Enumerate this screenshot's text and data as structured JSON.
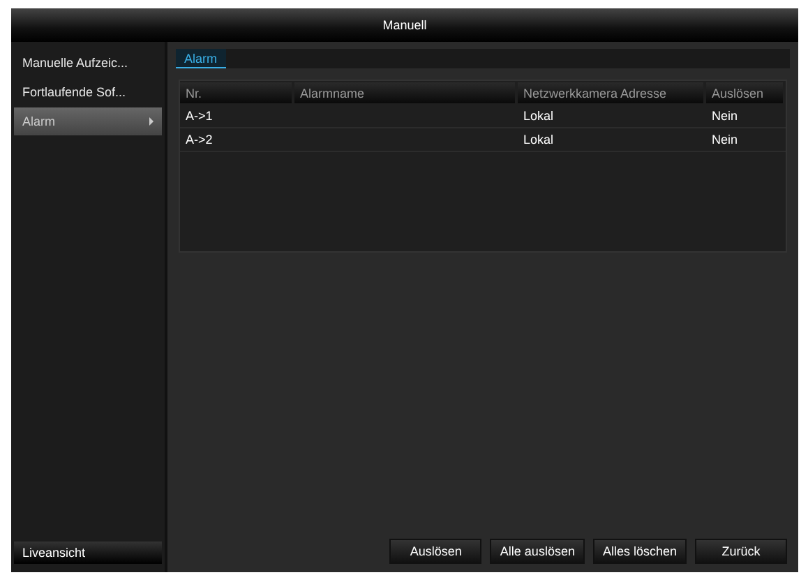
{
  "window": {
    "title": "Manuell"
  },
  "sidebar": {
    "items": [
      {
        "label": "Manuelle Aufzeic...",
        "selected": false
      },
      {
        "label": "Fortlaufende Sof...",
        "selected": false
      },
      {
        "label": "Alarm",
        "selected": true
      }
    ],
    "footer": "Liveansicht"
  },
  "tabs": [
    {
      "label": "Alarm",
      "selected": true
    }
  ],
  "table": {
    "columns": [
      "Nr.",
      "Alarmname",
      "Netzwerkkamera Adresse",
      "Auslösen"
    ],
    "rows": [
      [
        "A->1",
        "",
        "Lokal",
        "Nein"
      ],
      [
        "A->2",
        "",
        "Lokal",
        "Nein"
      ]
    ]
  },
  "buttons": [
    "Auslösen",
    "Alle auslösen",
    "Alles löschen",
    "Zurück"
  ]
}
